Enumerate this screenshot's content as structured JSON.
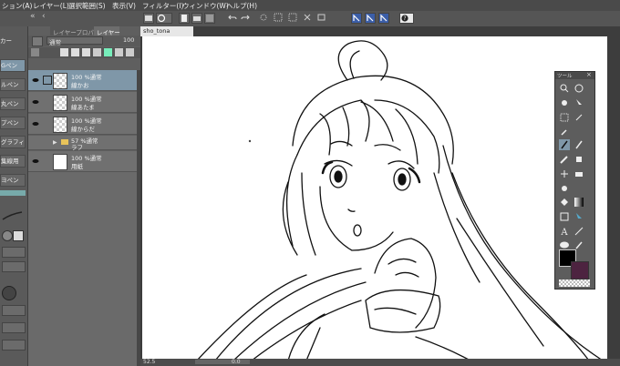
{
  "menu": {
    "items": [
      "ション(A)",
      "レイヤー(L)",
      "選択範囲(S)",
      "表示(V)",
      "フィルター(I)",
      "ウィンドウ(W)",
      "ヘルプ(H)"
    ]
  },
  "left_panel": {
    "header": "カー",
    "items": [
      "Gペン",
      "ルペン",
      "丸ペン",
      "プペン",
      "グラフィ",
      "集線用",
      "ヨペン"
    ]
  },
  "layer_panel": {
    "tabs": [
      "レイヤープロパティ",
      "レイヤー"
    ],
    "blend_mode": "通常",
    "opacity": "100",
    "layers": [
      {
        "props": "100 %通常",
        "name": "線かお",
        "selected": true,
        "kind": "raster"
      },
      {
        "props": "100 %通常",
        "name": "線あたま",
        "selected": false,
        "kind": "raster"
      },
      {
        "props": "100 %通常",
        "name": "線からだ",
        "selected": false,
        "kind": "raster"
      },
      {
        "props": "57 %通常",
        "name": "ラフ",
        "selected": false,
        "kind": "folder"
      },
      {
        "props": "100 %通常",
        "name": "用紙",
        "selected": false,
        "kind": "paper"
      }
    ]
  },
  "document": {
    "tab_label": "sho_tona"
  },
  "status": {
    "zoom": "52.5",
    "rotation": "0.0"
  },
  "tool_palette": {
    "title": "ツール"
  },
  "colors": {
    "main_color": "#000000",
    "sub_color": "#4d2340",
    "selection_accent": "#7f97a8"
  }
}
